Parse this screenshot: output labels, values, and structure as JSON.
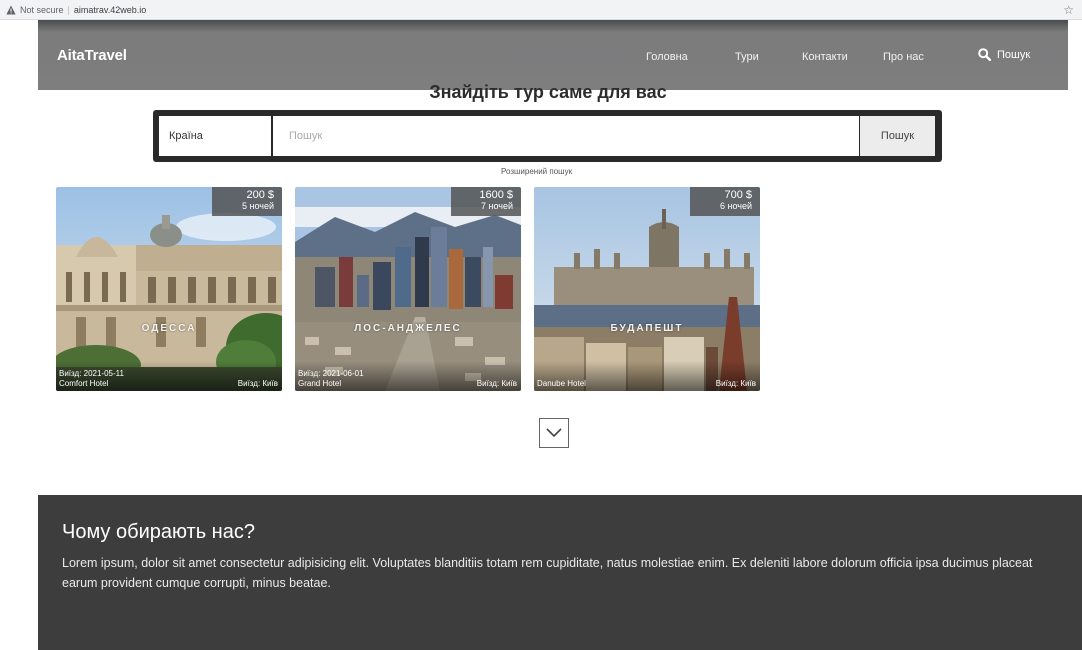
{
  "browser": {
    "security_label": "Not secure",
    "url": "aimatrav.42web.io"
  },
  "header": {
    "brand": "AitaTravel",
    "nav": [
      {
        "label": "Головна"
      },
      {
        "label": "Тури"
      },
      {
        "label": "Контакти"
      },
      {
        "label": "Про нас"
      }
    ],
    "search_label": "Пошук"
  },
  "search": {
    "title": "Знайдіть тур саме для вас",
    "country_label": "Країна",
    "placeholder": "Пошук",
    "button_label": "Пошук",
    "advanced_link": "Розширений пошук"
  },
  "tours": [
    {
      "price": "200 $",
      "nights": "5 ночей",
      "city": "ОДЕССА",
      "departure": "Виїзд: 2021-05-11",
      "hotel": "Comfort Hotel",
      "from": "Виїзд: Київ"
    },
    {
      "price": "1600 $",
      "nights": "7 ночей",
      "city": "ЛОС-АНДЖЕЛЕС",
      "departure": "Виїзд: 2021-06-01",
      "hotel": "Grand Hotel",
      "from": "Виїзд: Київ"
    },
    {
      "price": "700 $",
      "nights": "6 ночей",
      "city": "БУДАПЕШТ",
      "departure": "",
      "hotel": "Danube Hotel",
      "from": "Виїзд: Київ"
    }
  ],
  "why": {
    "title": "Чому обирають нас?",
    "text": "Lorem ipsum, dolor sit amet consectetur adipisicing elit. Voluptates blanditiis totam rem cupiditate, natus molestiae enim. Ex deleniti labore dolorum officia ipsa ducimus placeat earum provident cumque corrupti, minus beatae."
  },
  "colors": {
    "header_bg": "#7e7e7f",
    "footer_bg": "#3d3d3d",
    "search_frame": "#2a2a2a",
    "price_tag_bg": "#545454"
  }
}
